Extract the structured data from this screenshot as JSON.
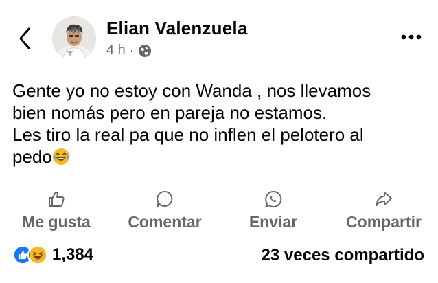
{
  "post": {
    "author": "Elian Valenzuela",
    "time": "4 h",
    "separator": "·",
    "privacy_icon": "globe-icon",
    "text_lines": [
      "Gente yo no estoy con Wanda , nos llevamos",
      "bien nomás pero en pareja no estamos.",
      "Les tiro la real pa que no inflen el pelotero al",
      "pedo"
    ],
    "end_emoji": "laughing-tears-emoji"
  },
  "actions": {
    "like": {
      "label": "Me gusta",
      "icon": "thumbs-up-outline-icon"
    },
    "comment": {
      "label": "Comentar",
      "icon": "comment-bubble-icon"
    },
    "send": {
      "label": "Enviar",
      "icon": "whatsapp-icon"
    },
    "share": {
      "label": "Compartir",
      "icon": "share-arrow-icon"
    }
  },
  "stats": {
    "reaction_icons": [
      "like-reaction-icon",
      "haha-reaction-icon"
    ],
    "reaction_count": "1,384",
    "shares": "23 veces compartido"
  },
  "colors": {
    "text": "#050505",
    "muted": "#65676b",
    "like_blue": "#1877f2",
    "haha_yellow": "#f7b928"
  }
}
